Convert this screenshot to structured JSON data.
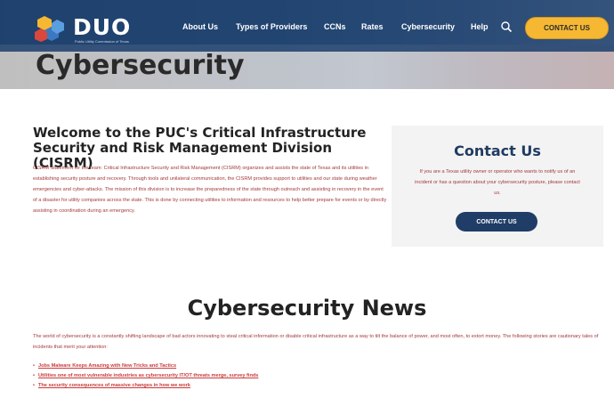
{
  "nav": {
    "logo_text": "DUO",
    "logo_subtitle": "Public Utility Commission of Texas",
    "links": [
      "About Us",
      "Types of Providers",
      "CCNs",
      "Rates",
      "Cybersecurity",
      "Help"
    ],
    "search_icon": "search-icon",
    "contact_label": "CONTACT US"
  },
  "page_title": "Cybersecurity",
  "welcome": {
    "heading": "Welcome to the PUC's Critical Infrastructure Security and Risk Management Division (CISRM)",
    "body": "CISRM Statement for the team: Critical Infrastructure Security and Risk Management (CISRM) organizes and assists the state of Texas and its utilities in establishing security posture and recovery. Through tools and unilateral communication, the CISRM provides support to utilities and our state during weather emergencies and cyber-attacks. The mission of this division is to increase the preparedness of the state through outreach and assisting in recovery in the event of a disaster for utility companies across the state. This is done by connecting utilities to information and resources to help better prepare for events or by directly assisting in coordination during an emergency."
  },
  "contact_box": {
    "heading": "Contact Us",
    "text": "If you are a Texas utility owner or operator who wants to notify us of an incident or has a question about your cybersecurity posture, please contact us.",
    "button_label": "CONTACT US"
  },
  "news": {
    "heading": "Cybersecurity News",
    "intro": "The world of cybersecurity is a constantly shifting landscape of bad actors innovating to steal critical information or disable critical infrastructure as a way to tilt the balance of power, and most often, to extort money. The following stories are cautionary tales of incidents that merit your attention:",
    "items": [
      "Jobs Malware Keeps Amazing with New Tricks and Tactics",
      "Utilities one of most vulnerable industries as cybersecurity IT/OT threats merge, survey finds",
      "The security consequences of massive changes in how we work"
    ]
  },
  "colors": {
    "nav_bg": "#20426e",
    "accent": "#f6b833",
    "heading_blue": "#1f3b61",
    "body_red": "#a33939"
  }
}
